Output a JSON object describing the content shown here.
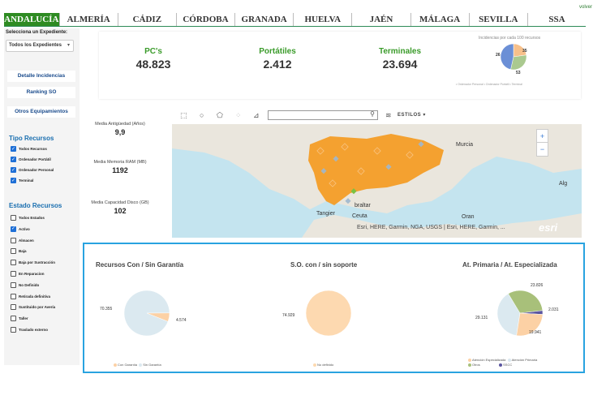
{
  "header": {
    "back_link": "volver",
    "tabs": [
      "ANDALUCÍA",
      "ALMERÍA",
      "CÁDIZ",
      "CÓRDOBA",
      "GRANADA",
      "HUELVA",
      "JAÉN",
      "MÁLAGA",
      "SEVILLA",
      "SSA"
    ],
    "active_tab": "ANDALUCÍA"
  },
  "sidebar": {
    "select_label": "Selecciona un Expediente:",
    "select_value": "Todos los Expedientes",
    "buttons": [
      "Detalle Incidencias",
      "Ranking SO",
      "Otros Equipamientos"
    ],
    "tipo_title": "Tipo Recursos",
    "tipo_items": [
      {
        "label": "Todos Recursos",
        "checked": true
      },
      {
        "label": "Ordenador Portátil",
        "checked": true
      },
      {
        "label": "Ordenador Personal",
        "checked": true
      },
      {
        "label": "Terminal",
        "checked": true
      }
    ],
    "estado_title": "Estado Recursos",
    "estado_items": [
      {
        "label": "Todos Estados",
        "checked": false
      },
      {
        "label": "Activo",
        "checked": true
      },
      {
        "label": "Almacen",
        "checked": false
      },
      {
        "label": "Baja",
        "checked": false
      },
      {
        "label": "Baja por Sustracción",
        "checked": false
      },
      {
        "label": "En Reparacion",
        "checked": false
      },
      {
        "label": "No Definido",
        "checked": false
      },
      {
        "label": "Retirada definitiva",
        "checked": false
      },
      {
        "label": "Sustituido por Avería",
        "checked": false
      },
      {
        "label": "Taller",
        "checked": false
      },
      {
        "label": "Traslado externo",
        "checked": false
      }
    ]
  },
  "kpis": {
    "pcs": {
      "label": "PC's",
      "value": "48.823"
    },
    "portatiles": {
      "label": "Portátiles",
      "value": "2.412"
    },
    "terminales": {
      "label": "Terminales",
      "value": "23.694"
    },
    "incidencias_title": "Incidencias por cada 100 recursos",
    "incidencias_values": [
      "26",
      "35",
      "53"
    ],
    "incidencias_legend": "• Ordenador Personal  • Ordenador Portátil  • Terminal"
  },
  "metrics": [
    {
      "label": "Media Antigüedad (Años)",
      "value": "9,9"
    },
    {
      "label": "Media Memoria RAM (MB)",
      "value": "1192"
    },
    {
      "label": "Media Capacidad Disco (GB)",
      "value": "102"
    }
  ],
  "map": {
    "search_placeholder": "",
    "styles_label": "ESTILOS",
    "zoom_in": "+",
    "zoom_out": "−",
    "places": [
      "Murcia",
      "Tangier",
      "Ceuta",
      "Oran",
      "Alg",
      "braltar"
    ],
    "attribution": "Esri, HERE, Garmin, NGA, USGS | Esri, HERE, Garmin, ...",
    "logo": "esri"
  },
  "charts": {
    "garantia": {
      "title": "Recursos Con / Sin Garantía",
      "labels": [
        "70.355",
        "4.574"
      ],
      "legend": [
        "Con Garantía",
        "Sin Garantía"
      ]
    },
    "soporte": {
      "title": "S.O. con / sin soporte",
      "labels": [
        "74.929"
      ],
      "legend": [
        "No definido"
      ]
    },
    "primaria": {
      "title": "At. Primaria / At. Especializada",
      "labels": [
        "23.826",
        "2.031",
        "19.941",
        "29.131"
      ],
      "legend": [
        "Atención Especializada",
        "Atención Primaria",
        "Otros",
        "SSCC"
      ]
    }
  },
  "chart_data": [
    {
      "type": "pie",
      "title": "Incidencias por cada 100 recursos",
      "categories": [
        "Ordenador Personal",
        "Ordenador Portátil",
        "Terminal"
      ],
      "values": [
        26,
        35,
        53
      ],
      "colors": [
        "#f7c08a",
        "#aac98f",
        "#6b8fd6"
      ]
    },
    {
      "type": "pie",
      "title": "Recursos Con / Sin Garantía",
      "categories": [
        "Sin Garantía",
        "Con Garantía"
      ],
      "values": [
        70355,
        4574
      ],
      "colors": [
        "#dbe9f0",
        "#fcd1a5"
      ]
    },
    {
      "type": "pie",
      "title": "S.O. con / sin soporte",
      "categories": [
        "No definido"
      ],
      "values": [
        74929
      ],
      "colors": [
        "#fdd9b0"
      ]
    },
    {
      "type": "pie",
      "title": "At. Primaria / At. Especializada",
      "categories": [
        "Atención Primaria",
        "Otros",
        "SSCC",
        "Atención Especializada"
      ],
      "values": [
        29131,
        23826,
        2031,
        19941
      ],
      "colors": [
        "#dbe9f0",
        "#a8c07a",
        "#5a55a0",
        "#fcd1a5"
      ]
    }
  ]
}
